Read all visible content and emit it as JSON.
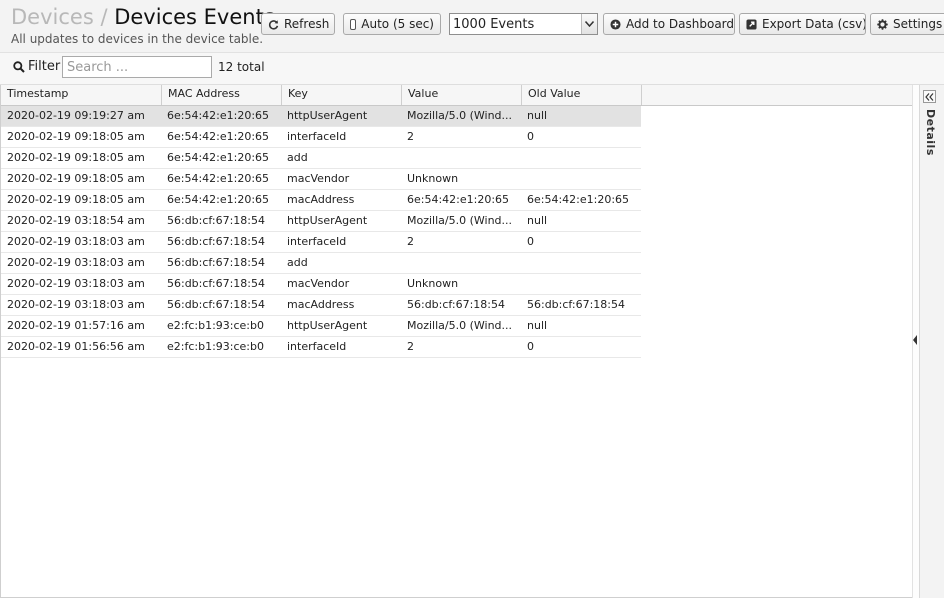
{
  "header": {
    "breadcrumb_parent": "Devices",
    "separator": "/",
    "title": "Devices Events",
    "subtitle": "All updates to devices in the device table."
  },
  "toolbar": {
    "refresh_label": "Refresh",
    "auto_label": "Auto (5 sec)",
    "events_select_value": "1000 Events",
    "add_dashboard_label": "Add to Dashboard",
    "export_label": "Export Data (csv)",
    "settings_label": "Settings"
  },
  "filter": {
    "label": "Filter",
    "placeholder": "Search ...",
    "total": "12 total"
  },
  "table": {
    "columns": [
      "Timestamp",
      "MAC Address",
      "Key",
      "Value",
      "Old Value"
    ],
    "rows": [
      [
        "2020-02-19 09:19:27 am",
        "6e:54:42:e1:20:65",
        "httpUserAgent",
        "Mozilla/5.0 (Wind...",
        "null"
      ],
      [
        "2020-02-19 09:18:05 am",
        "6e:54:42:e1:20:65",
        "interfaceId",
        "2",
        "0"
      ],
      [
        "2020-02-19 09:18:05 am",
        "6e:54:42:e1:20:65",
        "add",
        "",
        ""
      ],
      [
        "2020-02-19 09:18:05 am",
        "6e:54:42:e1:20:65",
        "macVendor",
        "Unknown",
        ""
      ],
      [
        "2020-02-19 09:18:05 am",
        "6e:54:42:e1:20:65",
        "macAddress",
        "6e:54:42:e1:20:65",
        "6e:54:42:e1:20:65"
      ],
      [
        "2020-02-19 03:18:54 am",
        "56:db:cf:67:18:54",
        "httpUserAgent",
        "Mozilla/5.0 (Wind...",
        "null"
      ],
      [
        "2020-02-19 03:18:03 am",
        "56:db:cf:67:18:54",
        "interfaceId",
        "2",
        "0"
      ],
      [
        "2020-02-19 03:18:03 am",
        "56:db:cf:67:18:54",
        "add",
        "",
        ""
      ],
      [
        "2020-02-19 03:18:03 am",
        "56:db:cf:67:18:54",
        "macVendor",
        "Unknown",
        ""
      ],
      [
        "2020-02-19 03:18:03 am",
        "56:db:cf:67:18:54",
        "macAddress",
        "56:db:cf:67:18:54",
        "56:db:cf:67:18:54"
      ],
      [
        "2020-02-19 01:57:16 am",
        "e2:fc:b1:93:ce:b0",
        "httpUserAgent",
        "Mozilla/5.0 (Wind...",
        "null"
      ],
      [
        "2020-02-19 01:56:56 am",
        "e2:fc:b1:93:ce:b0",
        "interfaceId",
        "2",
        "0"
      ]
    ],
    "selected_row": 0
  },
  "panel": {
    "label": "Details"
  },
  "icons": {
    "refresh": "refresh-icon",
    "add": "plus-circle-icon",
    "export": "external-link-icon",
    "settings": "gear-icon",
    "search": "search-icon",
    "collapse": "double-chevron-left-icon"
  }
}
